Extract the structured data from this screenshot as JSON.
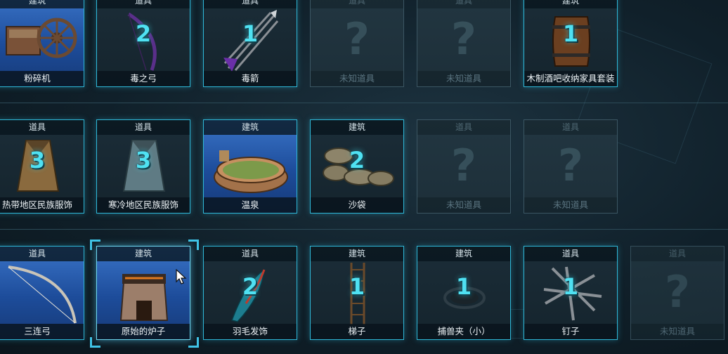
{
  "rows": [
    [
      {
        "category": "建筑",
        "name": "粉碎机",
        "count": "",
        "state": "blue",
        "icon": "crusher-icon"
      },
      {
        "category": "道具",
        "name": "毒之弓",
        "count": "2",
        "state": "dark",
        "icon": "poison-bow-icon"
      },
      {
        "category": "道具",
        "name": "毒箭",
        "count": "1",
        "state": "dark",
        "icon": "poison-arrow-icon"
      },
      {
        "category": "道具",
        "name": "未知道具",
        "count": "",
        "state": "unknown",
        "icon": "question-mark-icon"
      },
      {
        "category": "道具",
        "name": "未知道具",
        "count": "",
        "state": "unknown",
        "icon": "question-mark-icon"
      },
      {
        "category": "建筑",
        "name": "木制酒吧收纳家具套装",
        "count": "1",
        "state": "dark",
        "icon": "barrel-icon"
      }
    ],
    [
      {
        "category": "道具",
        "name": "热带地区民族服饰",
        "count": "3",
        "state": "dark",
        "icon": "tropical-outfit-icon"
      },
      {
        "category": "道具",
        "name": "寒冷地区民族服饰",
        "count": "3",
        "state": "dark",
        "icon": "cold-outfit-icon"
      },
      {
        "category": "建筑",
        "name": "温泉",
        "count": "",
        "state": "blue",
        "icon": "hot-spring-icon"
      },
      {
        "category": "建筑",
        "name": "沙袋",
        "count": "2",
        "state": "dark",
        "icon": "sandbag-icon"
      },
      {
        "category": "道具",
        "name": "未知道具",
        "count": "",
        "state": "unknown",
        "icon": "question-mark-icon"
      },
      {
        "category": "道具",
        "name": "未知道具",
        "count": "",
        "state": "unknown",
        "icon": "question-mark-icon"
      }
    ],
    [
      {
        "category": "道具",
        "name": "三连弓",
        "count": "",
        "state": "blue",
        "icon": "triple-bow-icon"
      },
      {
        "category": "建筑",
        "name": "原始的炉子",
        "count": "",
        "state": "blue",
        "icon": "furnace-icon"
      },
      {
        "category": "道具",
        "name": "羽毛发饰",
        "count": "2",
        "state": "dark",
        "icon": "feather-icon"
      },
      {
        "category": "建筑",
        "name": "梯子",
        "count": "1",
        "state": "dark",
        "icon": "ladder-icon"
      },
      {
        "category": "建筑",
        "name": "捕兽夹（小）",
        "count": "1",
        "state": "dark",
        "icon": "trap-icon"
      },
      {
        "category": "道具",
        "name": "钉子",
        "count": "1",
        "state": "dark",
        "icon": "nails-icon"
      },
      {
        "category": "道具",
        "name": "未知道具",
        "count": "",
        "state": "unknown",
        "icon": "question-mark-icon"
      }
    ]
  ],
  "selected": "原始的炉子",
  "colors": {
    "accent": "#2fb8d8",
    "count": "#4fe1f2",
    "blue_card": "#2a5fb0"
  }
}
